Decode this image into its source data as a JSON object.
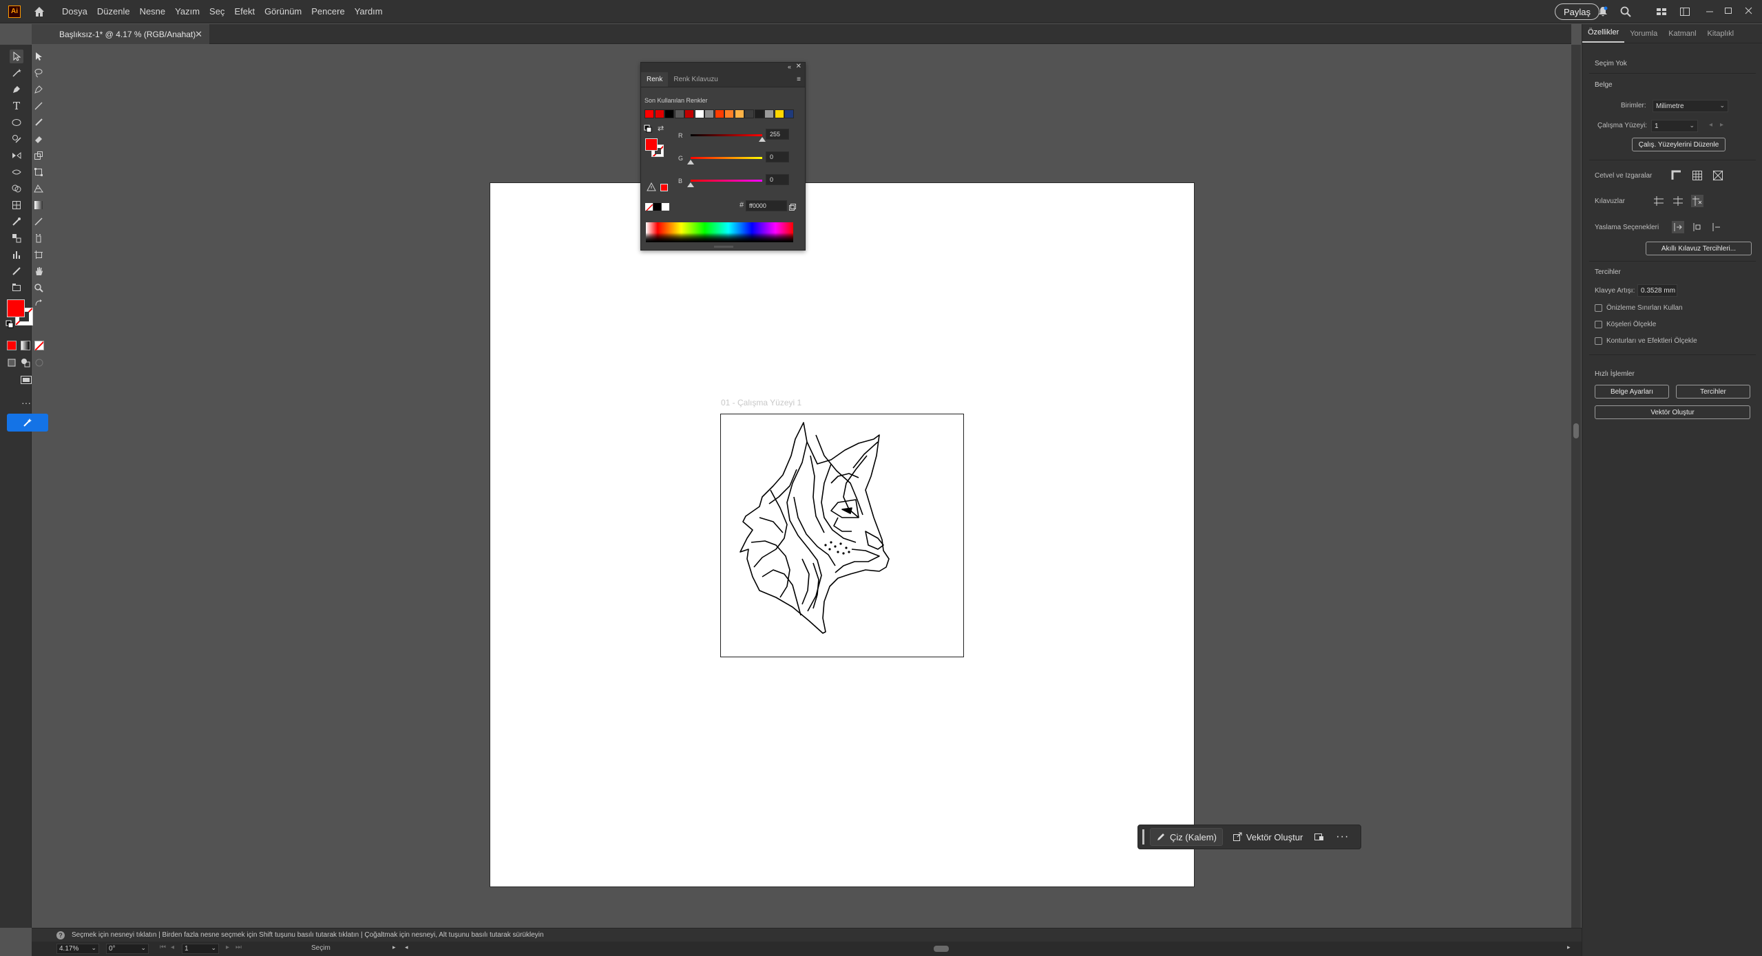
{
  "app": {
    "logo": "Ai",
    "menu": [
      "Dosya",
      "Düzenle",
      "Nesne",
      "Yazım",
      "Seç",
      "Efekt",
      "Görünüm",
      "Pencere",
      "Yardım"
    ],
    "share_label": "Paylaş"
  },
  "document": {
    "tab_title": "Başlıksız-1* @ 4.17 % (RGB/Anahat)",
    "artboard_label": "01 - Çalışma Yüzeyi 1"
  },
  "color_panel": {
    "tabs": [
      "Renk",
      "Renk Kılavuzu"
    ],
    "recent_label": "Son Kullanılan Renkler",
    "recent_swatches": [
      "#ff0000",
      "#e00000",
      "#000000",
      "#5a5a5a",
      "#c00000",
      "#ffffff",
      "#8c8c8c",
      "#ff3b00",
      "#ff7f27",
      "#ffb347",
      "#3c3c3c",
      "#1e1e1e",
      "#9a9a9a",
      "#ffd700",
      "#1f3a7a"
    ],
    "channels": [
      {
        "letter": "R",
        "value": "255",
        "fraction": 1.0,
        "gradient": "linear-gradient(to right,#000,#f00)"
      },
      {
        "letter": "G",
        "value": "0",
        "fraction": 0.0,
        "gradient": "linear-gradient(to right,#f00,#ff0)"
      },
      {
        "letter": "B",
        "value": "0",
        "fraction": 0.0,
        "gradient": "linear-gradient(to right,#f00,#f0f)"
      }
    ],
    "hex_label": "#",
    "hex_value": "ff0000"
  },
  "properties": {
    "tabs": [
      "Özellikler",
      "Yorumla",
      "Katmanl",
      "Kitaplıkl"
    ],
    "selection": "Seçim Yok",
    "document_title": "Belge",
    "units_label": "Birimler:",
    "units_value": "Milimetre",
    "artboard_label": "Çalışma Yüzeyi:",
    "artboard_value": "1",
    "edit_artboards": "Çalış. Yüzeylerini Düzenle",
    "rulers_label": "Cetvel ve Izgaralar",
    "guides_label": "Kılavuzlar",
    "snap_label": "Yaslama Seçenekleri",
    "smart_guides_btn": "Akıllı Kılavuz Tercihleri...",
    "prefs_title": "Tercihler",
    "keyboard_label": "Klavye Artışı:",
    "keyboard_value": "0.3528 mm",
    "checks": [
      "Önizleme Sınırları Kullan",
      "Köşeleri Ölçekle",
      "Konturları ve Efektleri Ölçekle"
    ],
    "quick_actions": "Hızlı İşlemler",
    "doc_setup": "Belge Ayarları",
    "prefs_btn": "Tercihler",
    "create_vector": "Vektör Oluştur"
  },
  "contextbar": {
    "draw_label": "Çiz (Kalem)",
    "vector_label": "Vektör Oluştur"
  },
  "status": {
    "hint": "Seçmek için nesneyi tıklatın  |  Birden fazla nesne seçmek için Shift tuşunu basılı tutarak tıklatın  |  Çoğaltmak için nesneyi, Alt tuşunu basılı tutarak sürükleyin",
    "zoom": "4.17%",
    "rotation": "0°",
    "artboard_nav": "1",
    "mode": "Seçim"
  },
  "colors": {
    "fill": "#ff0000",
    "accent": "#1473e6"
  }
}
